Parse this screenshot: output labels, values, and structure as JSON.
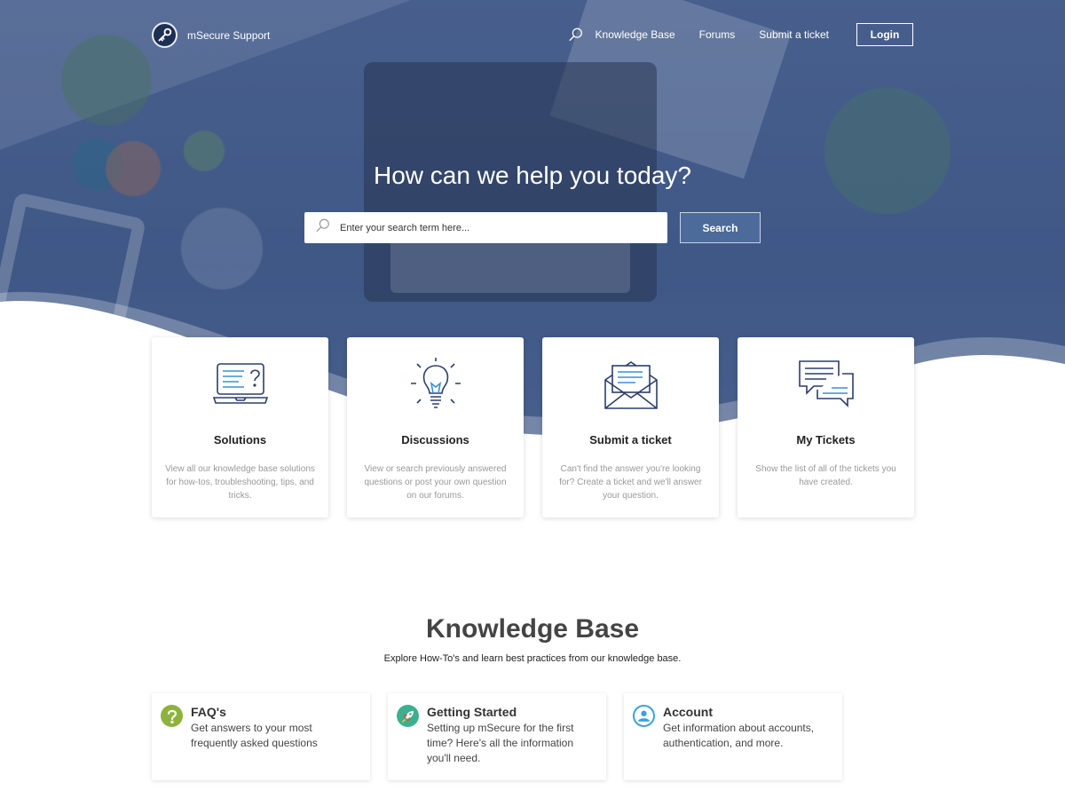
{
  "header": {
    "brand": "mSecure Support",
    "nav": [
      "Knowledge Base",
      "Forums",
      "Submit a ticket"
    ],
    "login_label": "Login"
  },
  "hero": {
    "title": "How can we help you today?",
    "search_placeholder": "Enter your search term here...",
    "search_button": "Search"
  },
  "cards": [
    {
      "title": "Solutions",
      "desc": "View all our knowledge base solutions for how-tos, troubleshooting, tips, and tricks.",
      "icon": "laptop-question-icon"
    },
    {
      "title": "Discussions",
      "desc": "View or search previously answered questions or post your own question on our forums.",
      "icon": "lightbulb-icon"
    },
    {
      "title": "Submit a ticket",
      "desc": "Can't find the answer you're looking for? Create a ticket and we'll answer your question.",
      "icon": "envelope-icon"
    },
    {
      "title": "My Tickets",
      "desc": "Show the list of all of the tickets you have created.",
      "icon": "chat-bubbles-icon"
    }
  ],
  "knowledge_base": {
    "title": "Knowledge Base",
    "subtitle": "Explore How-To's and learn best practices from our knowledge base.",
    "items": [
      {
        "title": "FAQ's",
        "desc": "Get answers to your most frequently asked questions",
        "icon": "question-icon",
        "color": "#8db33a"
      },
      {
        "title": "Getting Started",
        "desc": "Setting up mSecure for the first time? Here's all the information you'll need.",
        "icon": "rocket-icon",
        "color": "#3bb08f"
      },
      {
        "title": "Account",
        "desc": "Get information about accounts, authentication, and more.",
        "icon": "user-icon",
        "color": "#3aa3d9"
      }
    ]
  },
  "colors": {
    "accent": "#4c6a9a",
    "icon_stroke": "#2b3f6b",
    "icon_highlight": "#3b8fd9"
  }
}
